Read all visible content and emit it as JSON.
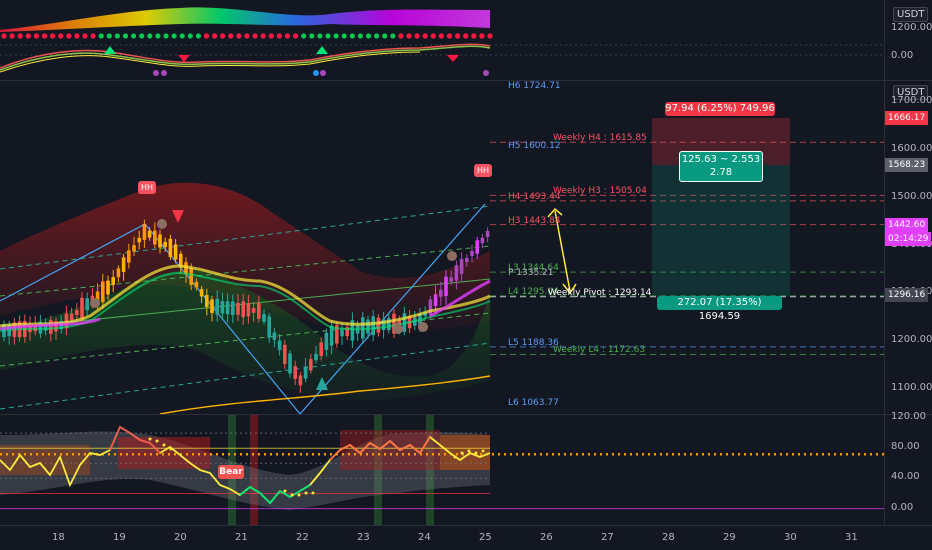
{
  "currency": "USDT",
  "top_pane": {
    "axis_ticks": [
      "1200.00",
      "0.00"
    ]
  },
  "main_pane": {
    "axis_ticks": [
      {
        "label": "1700.00",
        "value": 1700
      },
      {
        "label": "1600.00",
        "value": 1600
      },
      {
        "label": "1500.00",
        "value": 1500
      },
      {
        "label": "1400.00",
        "value": 1400
      },
      {
        "label": "1300.00",
        "value": 1300
      },
      {
        "label": "1200.00",
        "value": 1200
      },
      {
        "label": "1100.00",
        "value": 1100
      }
    ],
    "price_labels": [
      {
        "text": "1666.17",
        "value": 1666.17,
        "color": "#f23645"
      },
      {
        "text": "1568.23",
        "value": 1568.23,
        "color": "#5d606b"
      },
      {
        "text": "1442.60",
        "value": 1442.6,
        "color": "#e040fb"
      },
      {
        "text": "02:14:29",
        "value": 1442.6,
        "color": "#e040fb"
      },
      {
        "text": "1296.16",
        "value": 1296.16,
        "color": "#434651"
      }
    ],
    "levels": [
      {
        "text": "H6 1724.71",
        "value": 1724.71,
        "color": "#5b9cf6"
      },
      {
        "text": "H5 1600.12",
        "value": 1600.12,
        "color": "#5b9cf6"
      },
      {
        "text": "Weekly H4 : 1615.85",
        "value": 1615.85,
        "color": "#f7525f"
      },
      {
        "text": "H4 1493.44",
        "value": 1493.44,
        "color": "#f7525f"
      },
      {
        "text": "Weekly H3 : 1505.04",
        "value": 1505.04,
        "color": "#f7525f"
      },
      {
        "text": "H3 1443.84",
        "value": 1443.84,
        "color": "#f7525f"
      },
      {
        "text": "L3 1344.64",
        "value": 1344.64,
        "color": "#4caf50"
      },
      {
        "text": "P 1335.21",
        "value": 1335.21,
        "color": "#b2b5be"
      },
      {
        "text": "L4 1295.04",
        "value": 1295.04,
        "color": "#4caf50"
      },
      {
        "text": "Weekly Pivot : 1293.14",
        "value": 1293.14,
        "color": "#ffffff"
      },
      {
        "text": "L5 1188.36",
        "value": 1188.36,
        "color": "#5b9cf6"
      },
      {
        "text": "Weekly L4 : 1172.63",
        "value": 1172.63,
        "color": "#4caf50"
      },
      {
        "text": "L6 1063.77",
        "value": 1063.77,
        "color": "#5b9cf6"
      }
    ],
    "position_tool": {
      "target_label": "97.94 (6.25%) 749.96",
      "ratio_line1": "125.63 ~ 2.553",
      "ratio_line2": "2.78",
      "stop_label": "272.07 (17.35%) 1694.59"
    },
    "markers": {
      "hh": "HH"
    }
  },
  "bottom_pane": {
    "axis_ticks": [
      {
        "label": "120.00",
        "value": 120
      },
      {
        "label": "80.00",
        "value": 80
      },
      {
        "label": "40.00",
        "value": 40
      },
      {
        "label": "0.00",
        "value": 0
      }
    ],
    "bear_label": "Bear"
  },
  "x_axis": {
    "ticks": [
      "18",
      "19",
      "20",
      "21",
      "22",
      "23",
      "24",
      "25",
      "26",
      "27",
      "28",
      "29",
      "30",
      "31"
    ]
  },
  "colors": {
    "bg": "#131722",
    "up": "#26a69a",
    "down": "#ef5350",
    "grid": "#2a2e39"
  }
}
